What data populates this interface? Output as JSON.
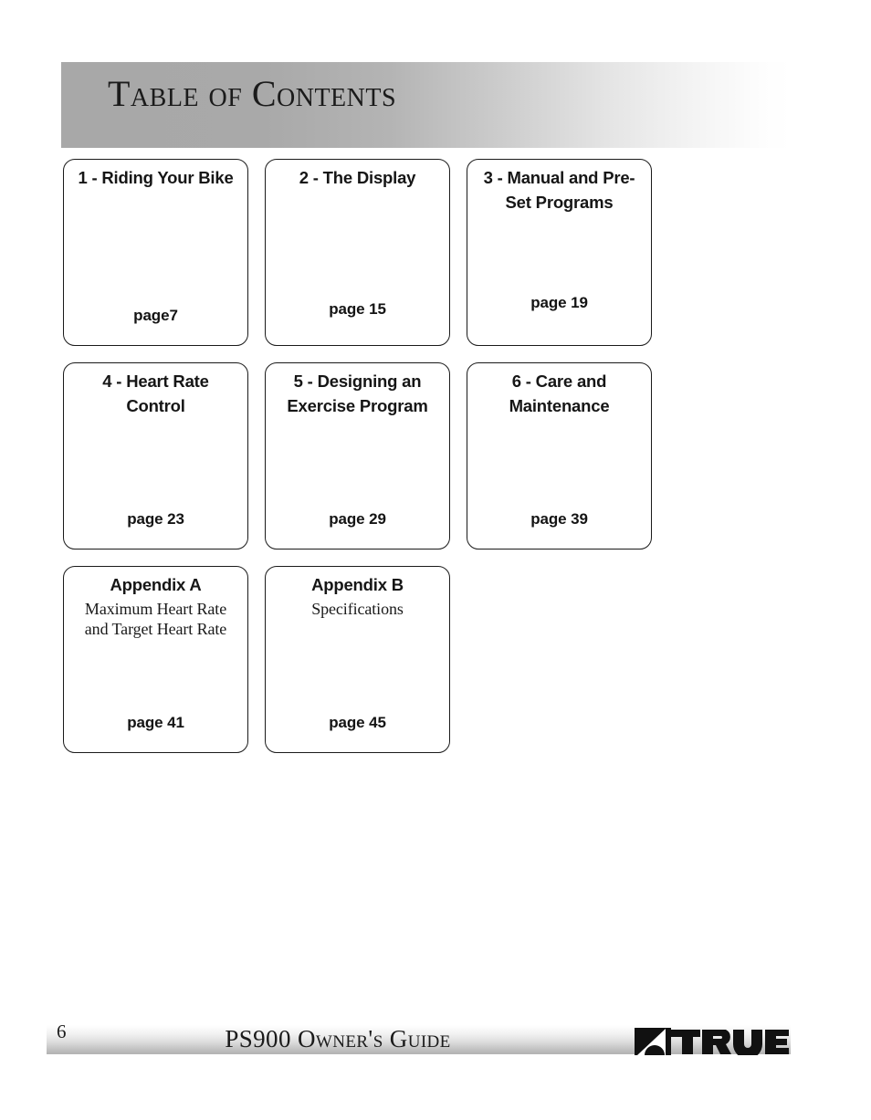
{
  "header": {
    "title": "Table of Contents"
  },
  "colors": {
    "header_gradient_start": "#a8a8a8",
    "header_gradient_end": "#ffffff",
    "footer_gradient_start": "#ffffff",
    "footer_gradient_end": "#b2b2b2",
    "box_border": "#1a1a1a",
    "text": "#161616",
    "logo": "#111111"
  },
  "contents": {
    "rows": [
      [
        {
          "title": "1 - Riding Your Bike",
          "subtitle": "",
          "page_label": "page7"
        },
        {
          "title": "2 - The Display",
          "subtitle": "",
          "page_label": "page 15"
        },
        {
          "title": "3 - Manual and Pre-Set Programs",
          "subtitle": "",
          "page_label": "page 19"
        }
      ],
      [
        {
          "title": "4 - Heart Rate Control",
          "subtitle": "",
          "page_label": "page 23"
        },
        {
          "title": "5 - Designing an Exercise Program",
          "subtitle": "",
          "page_label": "page 29"
        },
        {
          "title": "6 - Care and Maintenance",
          "subtitle": "",
          "page_label": "page 39"
        }
      ],
      [
        {
          "title": "Appendix A",
          "subtitle": "Maximum Heart Rate and Target Heart Rate",
          "page_label": "page 41"
        },
        {
          "title": "Appendix B",
          "subtitle": "Specifications",
          "page_label": "page 45"
        }
      ]
    ]
  },
  "footer": {
    "page_number": "6",
    "guide_title": "PS900 Owner's Guide",
    "brand": "TRUE",
    "brand_icon": "true-swoosh-logo"
  }
}
